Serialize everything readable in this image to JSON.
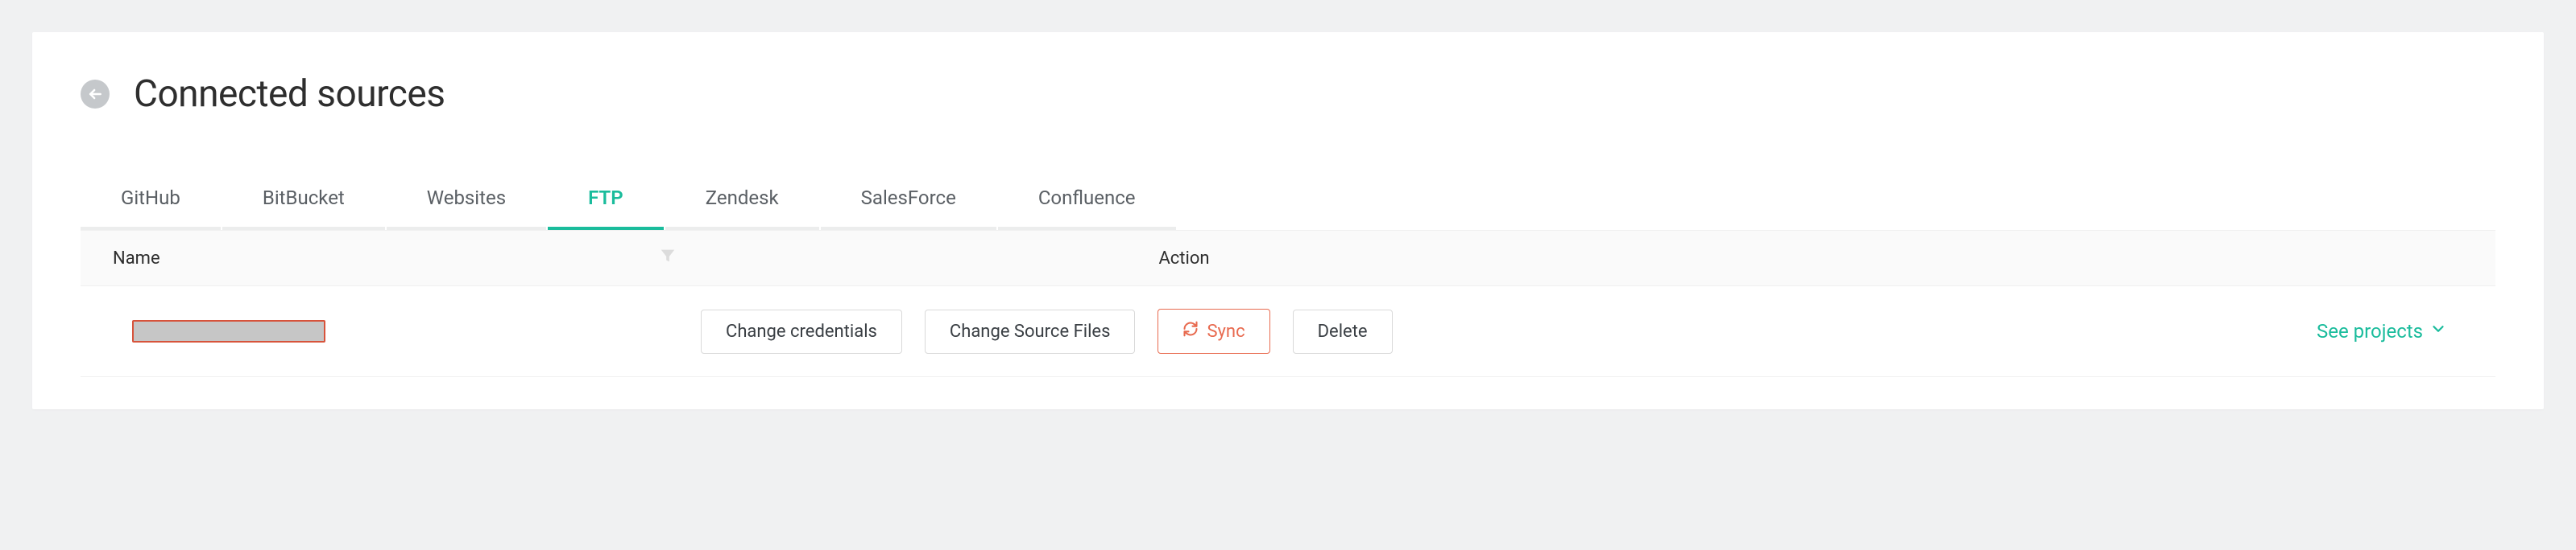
{
  "header": {
    "title": "Connected sources"
  },
  "tabs": {
    "items": [
      {
        "label": "GitHub",
        "active": false
      },
      {
        "label": "BitBucket",
        "active": false
      },
      {
        "label": "Websites",
        "active": false
      },
      {
        "label": "FTP",
        "active": true
      },
      {
        "label": "Zendesk",
        "active": false
      },
      {
        "label": "SalesForce",
        "active": false
      },
      {
        "label": "Confluence",
        "active": false
      }
    ]
  },
  "table": {
    "columns": {
      "name": "Name",
      "action": "Action"
    },
    "rows": [
      {
        "name": "",
        "actions": {
          "change_credentials": "Change credentials",
          "change_source_files": "Change Source Files",
          "sync": "Sync",
          "delete": "Delete"
        },
        "see_projects": "See projects"
      }
    ]
  }
}
